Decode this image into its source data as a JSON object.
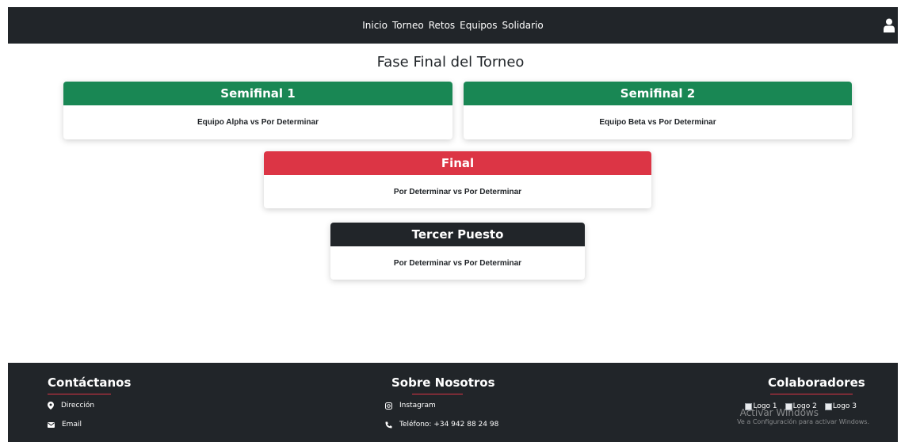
{
  "nav": {
    "links": [
      "Inicio",
      "Torneo",
      "Retos",
      "Equipos",
      "Solidario"
    ]
  },
  "page": {
    "title": "Fase Final del Torneo"
  },
  "matches": {
    "semifinal1": {
      "title": "Semifinal 1",
      "teams": "Equipo Alpha vs Por Determinar",
      "color": "#198754"
    },
    "semifinal2": {
      "title": "Semifinal 2",
      "teams": "Equipo Beta vs Por Determinar",
      "color": "#198754"
    },
    "final": {
      "title": "Final",
      "teams": "Por Determinar vs Por Determinar",
      "color": "#dc3545"
    },
    "third": {
      "title": "Tercer Puesto",
      "teams": "Por Determinar vs Por Determinar",
      "color": "#212529"
    }
  },
  "footer": {
    "contact": {
      "title": "Contáctanos",
      "address": "Dirección",
      "email": "Email"
    },
    "about": {
      "title": "Sobre Nosotros",
      "instagram": "Instagram",
      "phone": "Teléfono: +34 942 88 24 98"
    },
    "collaborators": {
      "title": "Colaboradores",
      "logos": [
        "Logo 1",
        "Logo 2",
        "Logo 3"
      ]
    },
    "watermark": {
      "line1": "Activar Windows",
      "line2": "Ve a Configuración para activar Windows."
    }
  },
  "icons": {
    "user": "user-icon",
    "address": "map-marker-icon",
    "email": "envelope-icon",
    "instagram": "instagram-icon",
    "phone": "phone-icon"
  }
}
